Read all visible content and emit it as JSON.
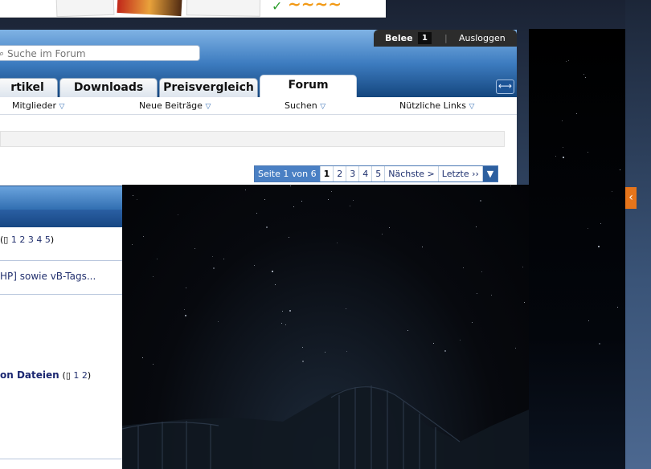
{
  "userbar": {
    "username": "Belee",
    "count": "1",
    "logout": "Ausloggen"
  },
  "search": {
    "placeholder": "Suche im Forum"
  },
  "tabs": [
    {
      "label": "rtikel"
    },
    {
      "label": "Downloads"
    },
    {
      "label": "Preisvergleich"
    },
    {
      "label": "Forum"
    }
  ],
  "subnav": [
    {
      "label": "Mitglieder"
    },
    {
      "label": "Neue Beiträge"
    },
    {
      "label": "Suchen"
    },
    {
      "label": "Nützliche Links"
    }
  ],
  "pagination": {
    "label": "Seite 1 von 6",
    "current": "1",
    "pages": [
      "2",
      "3",
      "4",
      "5"
    ],
    "next": "Nächste >",
    "last": "Letzte ››",
    "dropdown": "▼"
  },
  "threads": [
    {
      "title": "",
      "pages_prefix": "(",
      "pages": "1 2 3 4 5",
      "pages_suffix": ")"
    },
    {
      "title": "HP] sowie vB-Tags..."
    },
    {
      "title": ""
    },
    {
      "title": ""
    },
    {
      "title": "on Dateien",
      "pages_prefix": "(",
      "pages": "1 2",
      "pages_suffix": ")"
    },
    {
      "title": ""
    },
    {
      "title": ""
    }
  ],
  "icons": {
    "search": "search-icon",
    "collapse": "collapse-icon",
    "side_arrow": "chevron-left-icon",
    "subnav_arrow": "triangle-down-icon",
    "multipage": "multipage-icon"
  },
  "colors": {
    "header_blue": "#3d7cc0",
    "dark_navy": "#14467e",
    "side_tab_orange": "#e6751b"
  }
}
